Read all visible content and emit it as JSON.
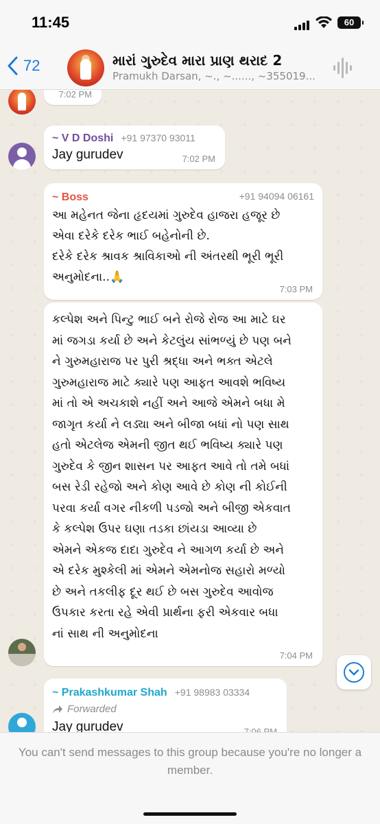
{
  "status": {
    "time": "11:45",
    "battery": "60"
  },
  "header": {
    "back_count": "72",
    "group_name": "મારાં ગુરુદેવ મારા પ્રાણ થરાદ 2",
    "subtitle": "Pramukh Darsan, ~., ~......, ~355019..."
  },
  "messages": [
    {
      "time": "7:02 PM"
    },
    {
      "sender": "~ V D Doshi",
      "phone": "+91 97370 93011",
      "text": "Jay gurudev",
      "time": "7:02 PM"
    },
    {
      "sender": "~ Boss",
      "phone": "+91 94094 06161",
      "lines": [
        "આ મહેનત જેના હૃદયમાં ગુરુદેવ હાજરા હજૂર છે",
        "એવા દરેકે દરેક ભાઈ બહેનોની છે.",
        "દરેકે દરેક શ્રાવક શ્રાવિકાઓ ની અંતરથી ભૂરી ભૂરી",
        "અનુમોદના..🙏"
      ],
      "time": "7:03 PM"
    },
    {
      "lines": [
        "કલ્પેશ અને પિન્ટુ ભાઈ બને રોજે રોજ આ માટે ઘર",
        "માં જગડા કર્યા છે અને કેટલુંય સાંભળ્યું છે પણ બને",
        "ને ગુરુમહારાજ પર પુરી શ્રદ્ધા અને ભક્ત એટલે",
        "ગુરુમહારાજ માટે ક્યારે પણ આફત આવશે ભવિષ્ય",
        "માં તો એ અચકાશે નહીં અને આજે એમને બધા મે",
        "જાગૃત કર્યા ને લડ્યા અને બીજા બધાં નો પણ સાથ",
        "હતો એટલેજ એમની જીત થઈ ભવિષ્ય ક્યારે પણ",
        "ગુરુદેવ કે જીન શાસન પર આફત આવે તો તમે બધાં",
        "બસ રેડી રહેજો અને કોણ આવે છે કોણ ની કોઈની",
        "પરવા કર્યા વગર નીકળી પડજો અને બીજી એકવાત",
        "કે કલ્પેશ ઉપર ઘણા તડકા છાંયડા આવ્યા છે",
        "એમને એકજ દાદા ગુરુદેવ ને આગળ કર્યા છે અને",
        "એ દરેક  મુશ્કેલી માં એમને એમનોજ સહારો મળ્યો",
        "છે અને તકલીફ દૂર થઈ છે બસ ગુરુદેવ આવોજ",
        "ઉપકાર કરતા રહે એવી પ્રાર્થના ફરી એકવાર બધા",
        "નાં સાથ ની અનુમોદના"
      ],
      "time": "7:04 PM"
    },
    {
      "sender": "~ Prakashkumar Shah",
      "phone": "+91 98983 03334",
      "forwarded": "Forwarded",
      "text": "Jay gurudev",
      "time": "7:06 PM"
    }
  ],
  "footer": {
    "notice": "You can't send messages to this group because you're no longer a member."
  },
  "colors": {
    "sender_vd": "#6e4d9c",
    "sender_boss": "#e5533d",
    "sender_prakash": "#1fa8c9",
    "accent": "#1b7cd6"
  }
}
